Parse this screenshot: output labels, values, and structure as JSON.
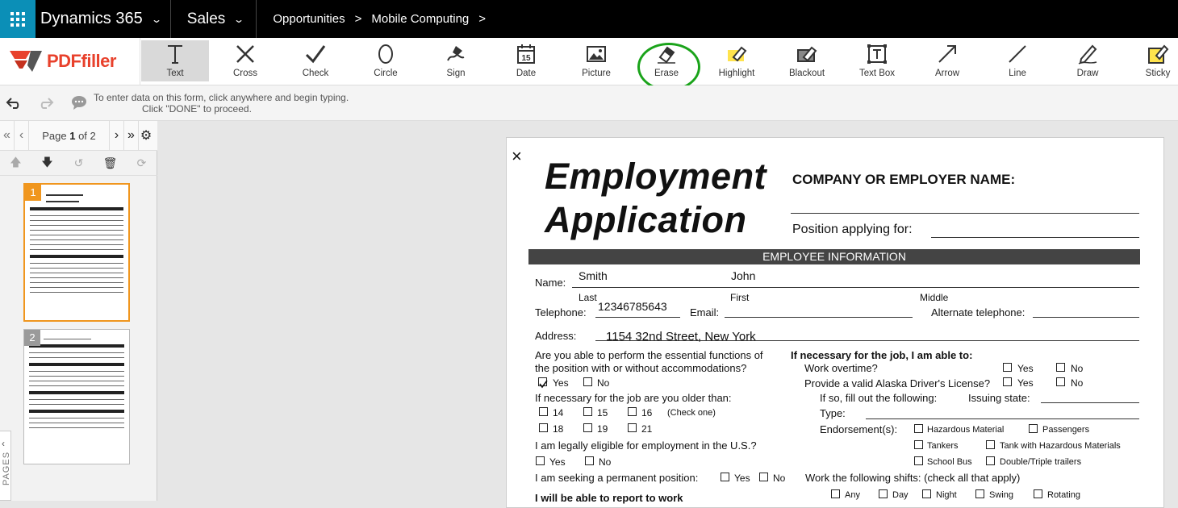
{
  "nav": {
    "app_title": "Dynamics 365",
    "module": "Sales",
    "breadcrumbs": [
      "Opportunities",
      "Mobile Computing"
    ],
    "crumb_sep": ">"
  },
  "toolbar": {
    "logo_text": "PDFfiller",
    "tools": [
      {
        "id": "text",
        "label": "Text",
        "icon": "text-icon"
      },
      {
        "id": "cross",
        "label": "Cross",
        "icon": "cross-icon"
      },
      {
        "id": "check",
        "label": "Check",
        "icon": "check-icon"
      },
      {
        "id": "circle",
        "label": "Circle",
        "icon": "circle-icon"
      },
      {
        "id": "sign",
        "label": "Sign",
        "icon": "sign-icon"
      },
      {
        "id": "date",
        "label": "Date",
        "icon": "calendar-icon"
      },
      {
        "id": "picture",
        "label": "Picture",
        "icon": "picture-icon"
      },
      {
        "id": "erase",
        "label": "Erase",
        "icon": "eraser-icon"
      },
      {
        "id": "highlight",
        "label": "Highlight",
        "icon": "highlighter-icon"
      },
      {
        "id": "blackout",
        "label": "Blackout",
        "icon": "blackout-icon"
      },
      {
        "id": "textbox",
        "label": "Text Box",
        "icon": "textbox-icon"
      },
      {
        "id": "arrow",
        "label": "Arrow",
        "icon": "arrow-icon"
      },
      {
        "id": "line",
        "label": "Line",
        "icon": "line-icon"
      },
      {
        "id": "draw",
        "label": "Draw",
        "icon": "pen-icon"
      },
      {
        "id": "sticky",
        "label": "Sticky",
        "icon": "sticky-note-icon"
      }
    ],
    "active_tool": "Text",
    "highlight_color": "#1aa31a",
    "date_icon_number": "15"
  },
  "hint": {
    "line1": "To enter data on this form, click anywhere and begin typing.",
    "line2": "Click \"DONE\" to proceed."
  },
  "pager": {
    "prefix": "Page",
    "current": "1",
    "mid": "of",
    "total": "2",
    "thumb_labels": [
      "1",
      "2"
    ],
    "side_tab": "PAGES"
  },
  "doc": {
    "close_glyph": "×",
    "title_line1": "Employment",
    "title_line2": "Application",
    "company_label": "COMPANY OR EMPLOYER NAME:",
    "position_label": "Position applying for:",
    "section_employee": "EMPLOYEE INFORMATION",
    "name_label": "Name:",
    "last_name_value": "Smith",
    "first_name_value": "John",
    "last_label": "Last",
    "first_label": "First",
    "middle_label": "Middle",
    "telephone_label": "Telephone:",
    "telephone_value": "12346785643",
    "email_label": "Email:",
    "alt_phone_label": "Alternate telephone:",
    "address_label": "Address:",
    "address_value": "1154 32nd Street, New York",
    "q_essential": "Are you able to perform the essential functions of",
    "q_essential2": "the position with or without accommodations?",
    "yes": "Yes",
    "no": "No",
    "q_older": "If necessary for the job are you older than:",
    "ages_row1": [
      "14",
      "15",
      "16"
    ],
    "ages_row2": [
      "18",
      "19",
      "21"
    ],
    "check_one": "(Check one)",
    "q_eligible": "I am legally eligible for employment in the U.S.?",
    "q_permanent": "I am seeking a permanent position:",
    "q_report": "I will be able to report to work",
    "able_header": "If necessary for the job, I am able to:",
    "q_overtime": "Work overtime?",
    "q_license": "Provide a valid Alaska Driver's License?",
    "fill_following": "If so, fill out the following:",
    "issuing_state": "Issuing state:",
    "type_label": "Type:",
    "endorsements_label": "Endorsement(s):",
    "endorsements": [
      "Hazardous Material",
      "Passengers",
      "Tankers",
      "Tank with Hazardous Materials",
      "School Bus",
      "Double/Triple trailers"
    ],
    "shifts_label": "Work the following shifts: (check all that apply)",
    "shifts": [
      "Any",
      "Day",
      "Night",
      "Swing",
      "Rotating"
    ]
  }
}
